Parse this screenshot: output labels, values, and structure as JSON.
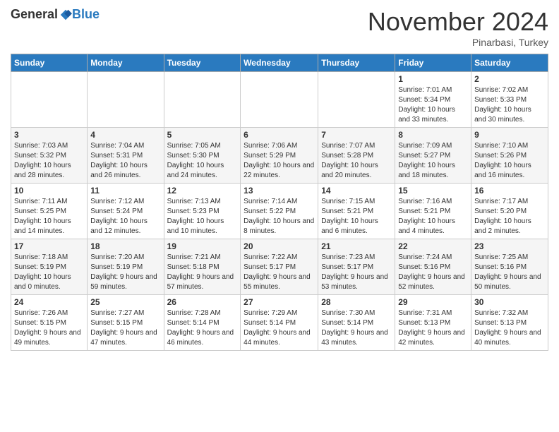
{
  "header": {
    "logo_general": "General",
    "logo_blue": "Blue",
    "month_title": "November 2024",
    "subtitle": "Pinarbasi, Turkey"
  },
  "days_of_week": [
    "Sunday",
    "Monday",
    "Tuesday",
    "Wednesday",
    "Thursday",
    "Friday",
    "Saturday"
  ],
  "weeks": [
    [
      {
        "day": "",
        "info": ""
      },
      {
        "day": "",
        "info": ""
      },
      {
        "day": "",
        "info": ""
      },
      {
        "day": "",
        "info": ""
      },
      {
        "day": "",
        "info": ""
      },
      {
        "day": "1",
        "info": "Sunrise: 7:01 AM\nSunset: 5:34 PM\nDaylight: 10 hours and 33 minutes."
      },
      {
        "day": "2",
        "info": "Sunrise: 7:02 AM\nSunset: 5:33 PM\nDaylight: 10 hours and 30 minutes."
      }
    ],
    [
      {
        "day": "3",
        "info": "Sunrise: 7:03 AM\nSunset: 5:32 PM\nDaylight: 10 hours and 28 minutes."
      },
      {
        "day": "4",
        "info": "Sunrise: 7:04 AM\nSunset: 5:31 PM\nDaylight: 10 hours and 26 minutes."
      },
      {
        "day": "5",
        "info": "Sunrise: 7:05 AM\nSunset: 5:30 PM\nDaylight: 10 hours and 24 minutes."
      },
      {
        "day": "6",
        "info": "Sunrise: 7:06 AM\nSunset: 5:29 PM\nDaylight: 10 hours and 22 minutes."
      },
      {
        "day": "7",
        "info": "Sunrise: 7:07 AM\nSunset: 5:28 PM\nDaylight: 10 hours and 20 minutes."
      },
      {
        "day": "8",
        "info": "Sunrise: 7:09 AM\nSunset: 5:27 PM\nDaylight: 10 hours and 18 minutes."
      },
      {
        "day": "9",
        "info": "Sunrise: 7:10 AM\nSunset: 5:26 PM\nDaylight: 10 hours and 16 minutes."
      }
    ],
    [
      {
        "day": "10",
        "info": "Sunrise: 7:11 AM\nSunset: 5:25 PM\nDaylight: 10 hours and 14 minutes."
      },
      {
        "day": "11",
        "info": "Sunrise: 7:12 AM\nSunset: 5:24 PM\nDaylight: 10 hours and 12 minutes."
      },
      {
        "day": "12",
        "info": "Sunrise: 7:13 AM\nSunset: 5:23 PM\nDaylight: 10 hours and 10 minutes."
      },
      {
        "day": "13",
        "info": "Sunrise: 7:14 AM\nSunset: 5:22 PM\nDaylight: 10 hours and 8 minutes."
      },
      {
        "day": "14",
        "info": "Sunrise: 7:15 AM\nSunset: 5:21 PM\nDaylight: 10 hours and 6 minutes."
      },
      {
        "day": "15",
        "info": "Sunrise: 7:16 AM\nSunset: 5:21 PM\nDaylight: 10 hours and 4 minutes."
      },
      {
        "day": "16",
        "info": "Sunrise: 7:17 AM\nSunset: 5:20 PM\nDaylight: 10 hours and 2 minutes."
      }
    ],
    [
      {
        "day": "17",
        "info": "Sunrise: 7:18 AM\nSunset: 5:19 PM\nDaylight: 10 hours and 0 minutes."
      },
      {
        "day": "18",
        "info": "Sunrise: 7:20 AM\nSunset: 5:19 PM\nDaylight: 9 hours and 59 minutes."
      },
      {
        "day": "19",
        "info": "Sunrise: 7:21 AM\nSunset: 5:18 PM\nDaylight: 9 hours and 57 minutes."
      },
      {
        "day": "20",
        "info": "Sunrise: 7:22 AM\nSunset: 5:17 PM\nDaylight: 9 hours and 55 minutes."
      },
      {
        "day": "21",
        "info": "Sunrise: 7:23 AM\nSunset: 5:17 PM\nDaylight: 9 hours and 53 minutes."
      },
      {
        "day": "22",
        "info": "Sunrise: 7:24 AM\nSunset: 5:16 PM\nDaylight: 9 hours and 52 minutes."
      },
      {
        "day": "23",
        "info": "Sunrise: 7:25 AM\nSunset: 5:16 PM\nDaylight: 9 hours and 50 minutes."
      }
    ],
    [
      {
        "day": "24",
        "info": "Sunrise: 7:26 AM\nSunset: 5:15 PM\nDaylight: 9 hours and 49 minutes."
      },
      {
        "day": "25",
        "info": "Sunrise: 7:27 AM\nSunset: 5:15 PM\nDaylight: 9 hours and 47 minutes."
      },
      {
        "day": "26",
        "info": "Sunrise: 7:28 AM\nSunset: 5:14 PM\nDaylight: 9 hours and 46 minutes."
      },
      {
        "day": "27",
        "info": "Sunrise: 7:29 AM\nSunset: 5:14 PM\nDaylight: 9 hours and 44 minutes."
      },
      {
        "day": "28",
        "info": "Sunrise: 7:30 AM\nSunset: 5:14 PM\nDaylight: 9 hours and 43 minutes."
      },
      {
        "day": "29",
        "info": "Sunrise: 7:31 AM\nSunset: 5:13 PM\nDaylight: 9 hours and 42 minutes."
      },
      {
        "day": "30",
        "info": "Sunrise: 7:32 AM\nSunset: 5:13 PM\nDaylight: 9 hours and 40 minutes."
      }
    ]
  ]
}
